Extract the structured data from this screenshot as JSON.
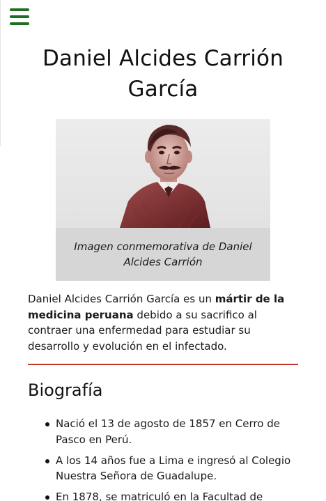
{
  "header": {
    "menu_icon": "hamburger-menu-icon",
    "menu_color": "#1f6f1f"
  },
  "article": {
    "title": "Daniel Alcides Carrión García",
    "figure": {
      "image_icon": "portrait-photo",
      "caption": "Imagen conmemorativa de Daniel Alcides Carrión"
    },
    "intro": {
      "part1": "Daniel Alcides Carrión García es un ",
      "bold": "mártir de la medicina peruana",
      "part2": " debido a su sacrifico al contraer una enfermedad para estudiar su desarrollo y evolución en el infectado."
    },
    "divider_color": "#c0392b",
    "section_heading": "Biografía",
    "bio_items": [
      "Nació el 13 de agosto de 1857 en Cerro de Pasco en Perú.",
      "A los 14 años fue a Lima e ingresó al Colegio Nuestra Señora de Guadalupe.",
      "En 1878, se matriculó en la Facultad de"
    ]
  }
}
